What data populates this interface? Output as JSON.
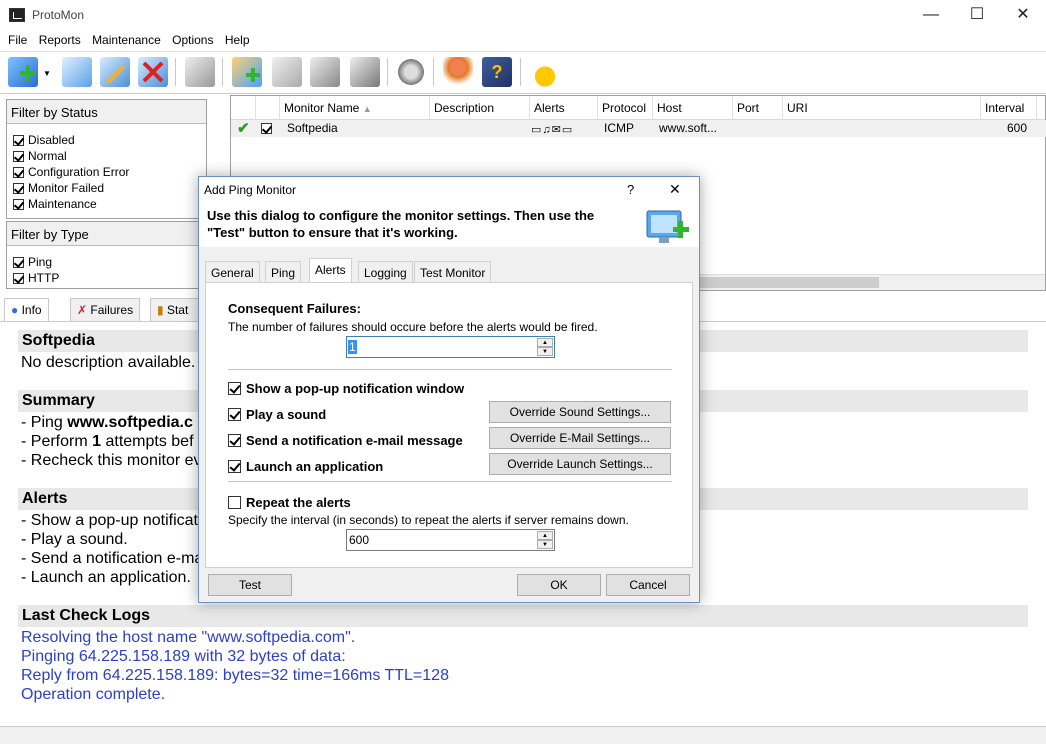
{
  "window": {
    "title": "ProtoMon",
    "minimize": "—",
    "maximize": "☐",
    "close": "✕"
  },
  "menu": [
    "File",
    "Reports",
    "Maintenance",
    "Options",
    "Help"
  ],
  "filter_status": {
    "title": "Filter by Status",
    "items": [
      {
        "label": "Disabled",
        "checked": true
      },
      {
        "label": "Normal",
        "checked": true
      },
      {
        "label": "Configuration Error",
        "checked": true
      },
      {
        "label": "Monitor Failed",
        "checked": true
      },
      {
        "label": "Maintenance",
        "checked": true
      }
    ]
  },
  "filter_type": {
    "title": "Filter by Type",
    "items": [
      {
        "label": "Ping",
        "checked": true
      },
      {
        "label": "HTTP",
        "checked": true
      }
    ]
  },
  "grid": {
    "columns": [
      "Monitor Name",
      "Description",
      "Alerts",
      "Protocol",
      "Host",
      "Port",
      "URI",
      "Interval"
    ],
    "sort_indicator": "▲",
    "row": {
      "name": "Softpedia",
      "description": "",
      "protocol": "ICMP",
      "host": "www.soft...",
      "port": "",
      "uri": "",
      "interval": "600"
    }
  },
  "lower_tabs": [
    "Info",
    "Failures",
    "Stat"
  ],
  "info": {
    "name": "Softpedia",
    "description": "No description available.",
    "summary_title": "Summary",
    "summary": [
      "- Ping ",
      "www.softpedia.c",
      "- Perform ",
      "1",
      " attempts bef",
      "- Recheck this monitor ev"
    ],
    "alerts_title": "Alerts",
    "alerts": [
      "- Show a pop-up notificat",
      "- Play a sound.",
      "- Send a notification e-ma",
      "- Launch an application."
    ],
    "logs_title": "Last Check Logs",
    "logs": [
      "Resolving the host name \"www.softpedia.com\".",
      "Pinging 64.225.158.189 with 32 bytes of data:",
      "Reply from 64.225.158.189: bytes=32 time=166ms TTL=128",
      "Operation complete."
    ]
  },
  "dialog": {
    "title": "Add Ping Monitor",
    "help": "?",
    "close": "✕",
    "desc": "Use this dialog to configure the monitor settings. Then use the \"Test\" button to ensure that it's working.",
    "tabs": [
      "General",
      "Ping",
      "Alerts",
      "Logging",
      "Test Monitor"
    ],
    "consequent_title": "Consequent Failures:",
    "consequent_desc": "The number of failures should occure before the alerts would be fired.",
    "consequent_value": "1",
    "popup": "Show a pop-up notification window",
    "sound": "Play a sound",
    "email": "Send a notification e-mail message",
    "launch": "Launch an application",
    "override_sound": "Override Sound Settings...",
    "override_email": "Override E-Mail Settings...",
    "override_launch": "Override Launch Settings...",
    "repeat": "Repeat the alerts",
    "repeat_desc": "Specify the interval (in seconds) to repeat the alerts if server remains down.",
    "repeat_value": "600",
    "test": "Test",
    "ok": "OK",
    "cancel": "Cancel"
  },
  "colors": {
    "accent": "#6b8fc7",
    "log_text": "#2c3fc9",
    "ok_check": "#2e9b2e"
  }
}
